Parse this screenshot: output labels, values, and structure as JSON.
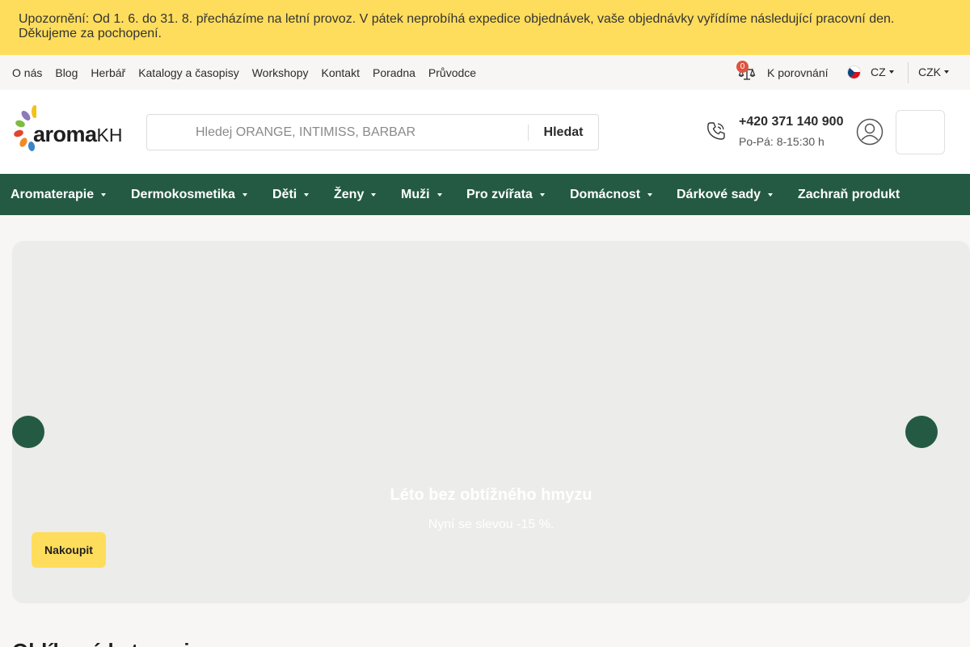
{
  "notice": {
    "text": "Upozornění: Od 1. 6. do 31. 8. přecházíme na letní provoz. V pátek neprobíhá expedice objednávek, vaše objednávky vyřídíme následující pracovní den. Děkujeme za pochopení."
  },
  "topnav": {
    "links": [
      "O nás",
      "Blog",
      "Herbář",
      "Katalogy a časopisy",
      "Workshopy",
      "Kontakt",
      "Poradna",
      "Průvodce"
    ]
  },
  "compare": {
    "count": "0",
    "label": "K porovnání"
  },
  "language": {
    "code": "CZ"
  },
  "currency": {
    "code": "CZK"
  },
  "logo": {
    "brand": "aroma",
    "suffix": "KH"
  },
  "search": {
    "placeholder": "Hledej ORANGE, INTIMISS, BARBAR",
    "button_label": "Hledat"
  },
  "contact": {
    "phone": "+420 371 140 900",
    "hours": "Po-Pá: 8-15:30 h"
  },
  "mainnav": {
    "items": [
      "Aromaterapie",
      "Dermokosmetika",
      "Děti",
      "Ženy",
      "Muži",
      "Pro zvířata",
      "Domácnost",
      "Dárkové sady",
      "Zachraň produkt"
    ]
  },
  "hero": {
    "title": "Léto bez obtížného hmyzu",
    "subtitle": "Nyní se slevou -15 %.",
    "button_label": "Nakoupit"
  },
  "section": {
    "title": "Oblíbené kategorie"
  },
  "colors": {
    "notice_bg": "#ffdd5c",
    "nav_green": "#245a43",
    "accent_yellow": "#ffdd5c",
    "badge_red": "#e0533e"
  }
}
